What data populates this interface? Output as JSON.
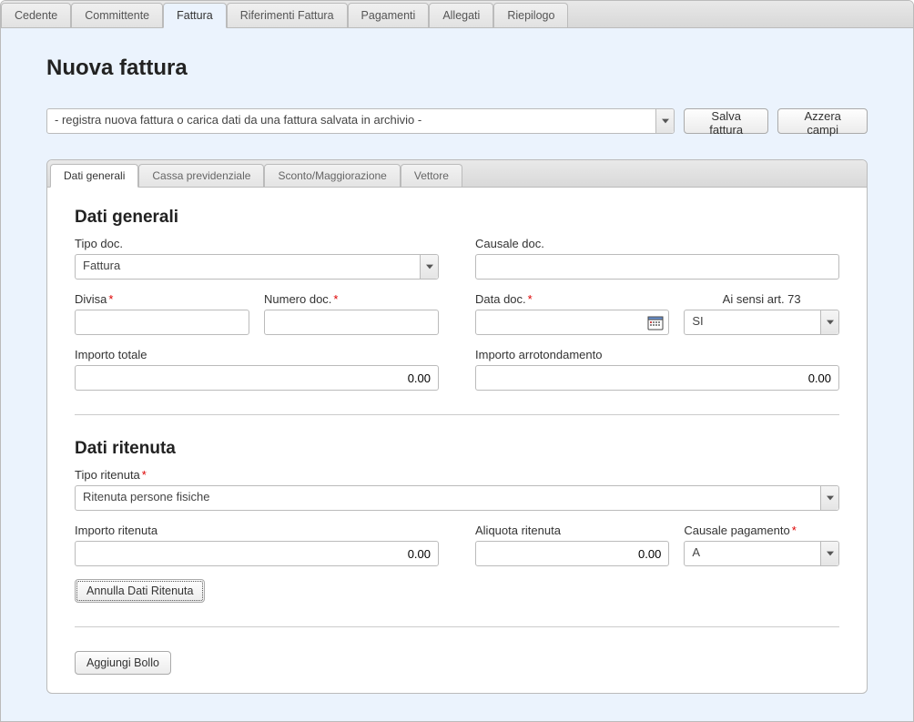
{
  "topTabs": {
    "items": [
      {
        "label": "Cedente"
      },
      {
        "label": "Committente"
      },
      {
        "label": "Fattura"
      },
      {
        "label": "Riferimenti Fattura"
      },
      {
        "label": "Pagamenti"
      },
      {
        "label": "Allegati"
      },
      {
        "label": "Riepilogo"
      }
    ],
    "activeIndex": 2
  },
  "page": {
    "title": "Nuova fattura",
    "archiveSelect": "- registra nuova fattura o carica dati da una fattura salvata in archivio -",
    "saveBtn": "Salva fattura",
    "resetBtn": "Azzera campi"
  },
  "subTabs": {
    "items": [
      {
        "label": "Dati generali"
      },
      {
        "label": "Cassa previdenziale"
      },
      {
        "label": "Sconto/Maggiorazione"
      },
      {
        "label": "Vettore"
      }
    ],
    "activeIndex": 0
  },
  "datiGenerali": {
    "heading": "Dati generali",
    "tipoDoc": {
      "label": "Tipo doc.",
      "value": "Fattura"
    },
    "causaleDoc": {
      "label": "Causale doc.",
      "value": ""
    },
    "divisa": {
      "label": "Divisa",
      "value": ""
    },
    "numeroDoc": {
      "label": "Numero doc.",
      "value": ""
    },
    "dataDoc": {
      "label": "Data doc.",
      "value": ""
    },
    "art73": {
      "label": "Ai sensi art. 73",
      "value": "SI"
    },
    "importoTotale": {
      "label": "Importo totale",
      "value": "0.00"
    },
    "importoArrot": {
      "label": "Importo arrotondamento",
      "value": "0.00"
    }
  },
  "datiRitenuta": {
    "heading": "Dati ritenuta",
    "tipo": {
      "label": "Tipo ritenuta",
      "value": "Ritenuta persone fisiche"
    },
    "importo": {
      "label": "Importo ritenuta",
      "value": "0.00"
    },
    "aliquota": {
      "label": "Aliquota ritenuta",
      "value": "0.00"
    },
    "causalePag": {
      "label": "Causale pagamento",
      "value": "A"
    },
    "annullaBtn": "Annulla Dati Ritenuta"
  },
  "bollo": {
    "aggiungiBtn": "Aggiungi Bollo"
  }
}
